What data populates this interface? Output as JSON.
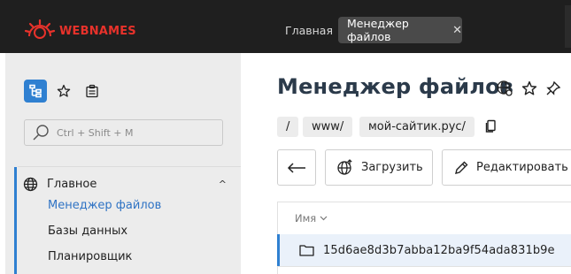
{
  "brand": {
    "name": "WEBNAMES",
    "color": "#e8322b"
  },
  "tabs": [
    {
      "label": "Главная"
    },
    {
      "label": "Менеджер файлов"
    }
  ],
  "sidebar": {
    "search_placeholder": "Ctrl + Shift + M",
    "section": {
      "label": "Главное"
    },
    "items": [
      {
        "label": "Менеджер файлов"
      },
      {
        "label": "Базы данных"
      },
      {
        "label": "Планировщик"
      }
    ]
  },
  "main": {
    "title": "Менеджер файлов",
    "breadcrumbs": [
      "/",
      "www/",
      "мой-сайтик.рус/"
    ],
    "buttons": {
      "upload": "Загрузить",
      "edit": "Редактировать"
    },
    "table": {
      "column_name": "Имя",
      "rows": [
        {
          "name": "15d6ae8d3b7abba12ba9f54ada831b9e"
        }
      ]
    }
  },
  "colors": {
    "accent": "#2f80d1",
    "topbar": "#1f1f1f",
    "sidebar": "#ececec"
  }
}
